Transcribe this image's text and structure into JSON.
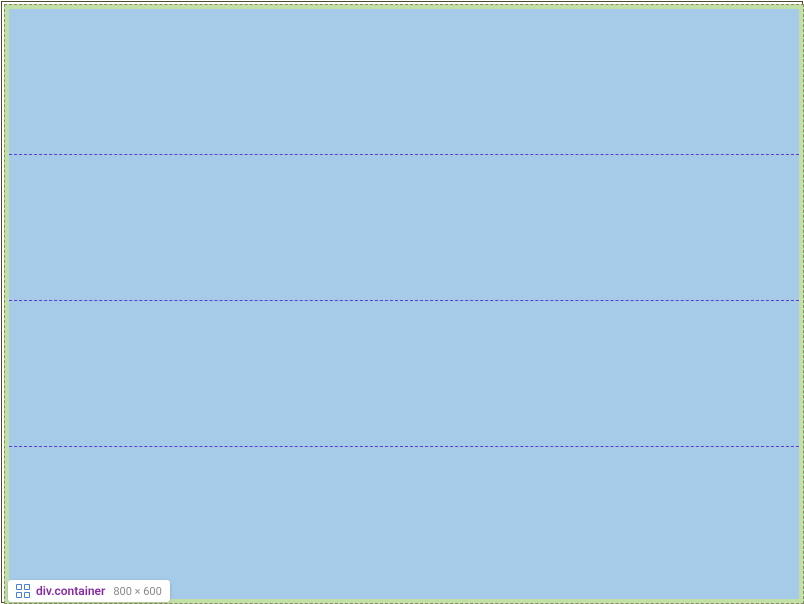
{
  "inspector": {
    "tag": "div",
    "class_prefix": ".",
    "class_name": "container",
    "dimensions": "800 × 600"
  }
}
